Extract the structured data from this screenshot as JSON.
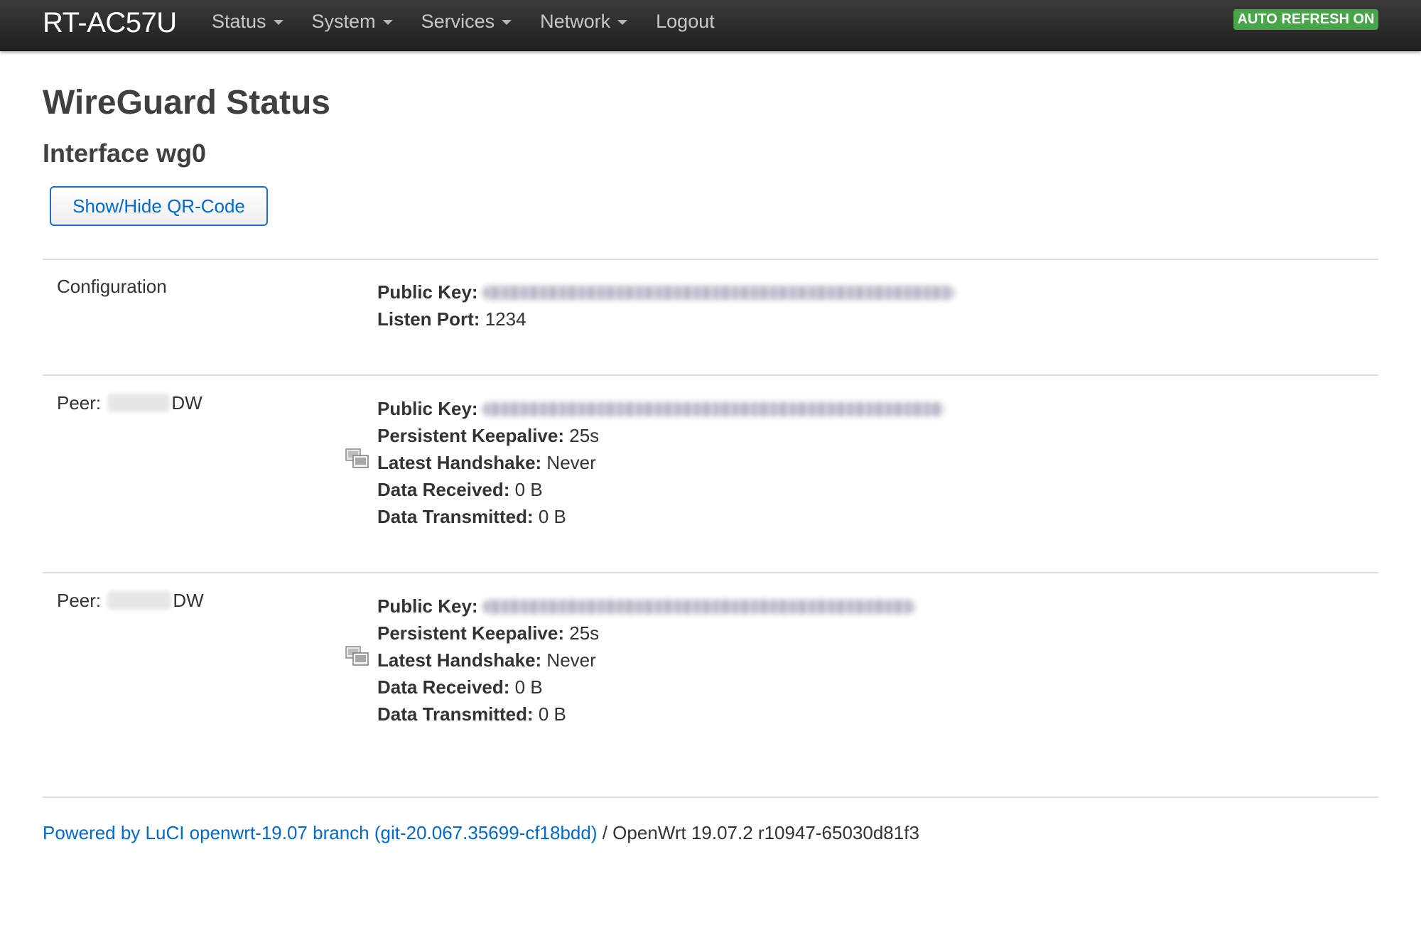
{
  "header": {
    "brand": "RT-AC57U",
    "menu": [
      {
        "label": "Status",
        "has_dropdown": true
      },
      {
        "label": "System",
        "has_dropdown": true
      },
      {
        "label": "Services",
        "has_dropdown": true
      },
      {
        "label": "Network",
        "has_dropdown": true
      },
      {
        "label": "Logout",
        "has_dropdown": false
      }
    ],
    "auto_refresh_badge": "AUTO REFRESH ON"
  },
  "main": {
    "title": "WireGuard Status",
    "interface_title": "Interface wg0",
    "qr_button_label": "Show/Hide QR-Code",
    "configuration": {
      "label": "Configuration",
      "public_key_label": "Public Key:",
      "listen_port_label": "Listen Port:",
      "listen_port_value": "1234"
    },
    "peers": [
      {
        "label_prefix": "Peer:",
        "label_suffix": "DW",
        "public_key_label": "Public Key:",
        "keepalive_label": "Persistent Keepalive:",
        "keepalive_value": "25s",
        "handshake_label": "Latest Handshake:",
        "handshake_value": "Never",
        "received_label": "Data Received:",
        "received_value": "0 B",
        "transmitted_label": "Data Transmitted:",
        "transmitted_value": "0 B",
        "icon": "peer-status-icon"
      },
      {
        "label_prefix": "Peer:",
        "label_suffix": "DW",
        "public_key_label": "Public Key:",
        "keepalive_label": "Persistent Keepalive:",
        "keepalive_value": "25s",
        "handshake_label": "Latest Handshake:",
        "handshake_value": "Never",
        "received_label": "Data Received:",
        "received_value": "0 B",
        "transmitted_label": "Data Transmitted:",
        "transmitted_value": "0 B",
        "icon": "peer-status-icon"
      }
    ]
  },
  "footer": {
    "link_text": "Powered by LuCI openwrt-19.07 branch (git-20.067.35699-cf18bdd)",
    "separator": " / ",
    "version_text": "OpenWrt 19.07.2 r10947-65030d81f3"
  },
  "colors": {
    "navbar_bg": "#2b2b2b",
    "badge_bg": "#46a546",
    "link": "#0069d6",
    "heading": "#404040"
  }
}
